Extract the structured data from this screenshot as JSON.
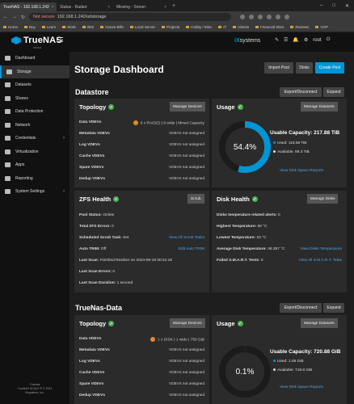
{
  "browser": {
    "tabs": [
      {
        "label": "TrueNAS - 192.168.1.242"
      },
      {
        "label": "Status - Radarr"
      },
      {
        "label": "Missing - Sonarr"
      }
    ],
    "url_warning": "Not secure",
    "url": "192.168.1.242/ui/storage",
    "bookmarks": [
      "Home",
      "Buy",
      "Learn",
      "Work",
      "IWS",
      "House Bills",
      "Local Server",
      "Projects",
      "Hobby / Misc",
      "IT",
      "Clients",
      "Financial Sites",
      "Reviews",
      "VGP"
    ]
  },
  "app": {
    "logo": "TrueNAS",
    "logo_sub": "SCALE",
    "vendor": "systems",
    "vendor_prefix": "iX",
    "user": "root"
  },
  "sidebar": {
    "items": [
      {
        "label": "Dashboard"
      },
      {
        "label": "Storage"
      },
      {
        "label": "Datasets"
      },
      {
        "label": "Shares"
      },
      {
        "label": "Data Protection"
      },
      {
        "label": "Network"
      },
      {
        "label": "Credentials"
      },
      {
        "label": "Virtualization"
      },
      {
        "label": "Apps"
      },
      {
        "label": "Reporting"
      },
      {
        "label": "System Settings"
      }
    ],
    "footer_hostname": "Truenas",
    "footer_copyright": "TrueNAS SCALE ® © 2024",
    "footer_company": "iXsystems, Inc."
  },
  "page": {
    "title": "Storage Dashboard",
    "import_pool": "Import Pool",
    "disks": "Disks",
    "create_pool": "Create Pool"
  },
  "pools": [
    {
      "name": "Datastore",
      "export": "Export/Disconnect",
      "expand": "Expand",
      "topology": {
        "title": "Topology",
        "manage": "Manage Devices",
        "rows": [
          {
            "k": "Data VDEVs",
            "v": "6 x RAIDZ2 | 6 wide | Mixed Capacity"
          },
          {
            "k": "Metadata VDEVs",
            "v": "VDEVs not assigned"
          },
          {
            "k": "Log VDEVs",
            "v": "VDEVs not assigned"
          },
          {
            "k": "Cache VDEVs",
            "v": "VDEVs not assigned"
          },
          {
            "k": "Spare VDEVs",
            "v": "VDEVs not assigned"
          },
          {
            "k": "Dedup VDEVs",
            "v": "VDEVs not assigned"
          }
        ]
      },
      "usage": {
        "title": "Usage",
        "manage": "Manage Datasets",
        "percent": "54.4%",
        "percent_value": 54.4,
        "capacity": "Usable Capacity: 217.88 TiB",
        "used": "Used: 118.58 TiB",
        "available": "Available: 99.3 TiB",
        "report_link": "View Disk Space Reports"
      },
      "zfs": {
        "title": "ZFS Health",
        "scrub": "Scrub",
        "rows": [
          {
            "k": "Pool Status:",
            "v": "Online"
          },
          {
            "k": "Total ZFS Errors:",
            "v": "0"
          },
          {
            "k": "Scheduled Scrub Task:",
            "v": "Set",
            "link": "View All Scrub Tasks"
          },
          {
            "k": "Auto TRIM:",
            "v": "Off",
            "link": "Edit Auto TRIM"
          },
          {
            "k": "Last Scan:",
            "v": "Finished Resilver on 2024-08-19 00:21:19"
          },
          {
            "k": "Last Scan Errors:",
            "v": "0"
          },
          {
            "k": "Last Scan Duration:",
            "v": "1 second"
          }
        ]
      },
      "disk": {
        "title": "Disk Health",
        "manage": "Manage Disks",
        "rows": [
          {
            "k": "Disks temperature related alerts:",
            "v": "0"
          },
          {
            "k": "Highest Temperature:",
            "v": "60 °C"
          },
          {
            "k": "Lowest Temperature:",
            "v": "23 °C"
          },
          {
            "k": "Average Disk Temperature:",
            "v": "46.357 °C",
            "link": "View Disks Temperature"
          },
          {
            "k": "Failed S.M.A.R.T. Tests:",
            "v": "0",
            "link": "View All S.M.A.R.T. Tests"
          }
        ]
      }
    },
    {
      "name": "TrueNas-Data",
      "export": "Export/Disconnect",
      "expand": "Expand",
      "topology": {
        "title": "Topology",
        "manage": "Manage Devices",
        "rows": [
          {
            "k": "Data VDEVs",
            "v": "1 x DISK | 1 wide | 750 GiB"
          },
          {
            "k": "Metadata VDEVs",
            "v": "VDEVs not assigned"
          },
          {
            "k": "Log VDEVs",
            "v": "VDEVs not assigned"
          },
          {
            "k": "Cache VDEVs",
            "v": "VDEVs not assigned"
          },
          {
            "k": "Spare VDEVs",
            "v": "VDEVs not assigned"
          },
          {
            "k": "Dedup VDEVs",
            "v": "VDEVs not assigned"
          }
        ]
      },
      "usage": {
        "title": "Usage",
        "manage": "Manage Datasets",
        "percent": "0.1%",
        "percent_value": 0.1,
        "capacity": "Usable Capacity: 720.88 GiB",
        "used": "Used: 1.08 GiB",
        "available": "Available: 719.8 GiB",
        "report_link": "View Disk Space Reports"
      }
    }
  ],
  "colors": {
    "accent": "#0095d5",
    "ok": "#4caf50",
    "warn": "#e08a2c",
    "link": "#4fa7e8"
  }
}
